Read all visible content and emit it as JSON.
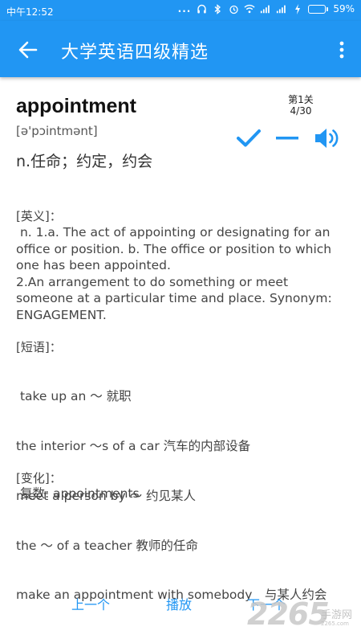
{
  "status_bar": {
    "time": "中午12:52",
    "dots": "...",
    "battery": "59%",
    "battery_level": 0.59
  },
  "app_bar": {
    "title": "大学英语四级精选"
  },
  "word": {
    "text": "appointment",
    "phonetic": "[ə'pɔintmənt]",
    "meaning": "n.任命；约定，约会"
  },
  "level": {
    "label": "第1关",
    "progress": "4/30"
  },
  "sections": {
    "english": {
      "header": "[英义]：",
      "content": " n. 1.a. The act of appointing or designating for an office or position. b. The office or position to which one has been appointed.\n2.An arrangement to do something or meet someone at a particular time and place. Synonym: ENGAGEMENT."
    },
    "phrases": {
      "header": "[短语]：",
      "items": [
        " take up an ～ 就职",
        "the interior ～s of a car 汽车的内部设备",
        "meet a person by ～ 约见某人",
        "the ～ of a teacher 教师的任命",
        "make an appointment with somebody　与某人约会"
      ]
    },
    "inflection": {
      "header": "[变化]：",
      "content": " 复数: appointments"
    }
  },
  "bottom_nav": {
    "prev": "上一个",
    "play": "播放",
    "next": "下一个"
  },
  "watermark": {
    "number": "2265",
    "label": "手游网",
    "url": "2265.com"
  },
  "colors": {
    "primary": "#2196f3",
    "text": "#444444"
  }
}
